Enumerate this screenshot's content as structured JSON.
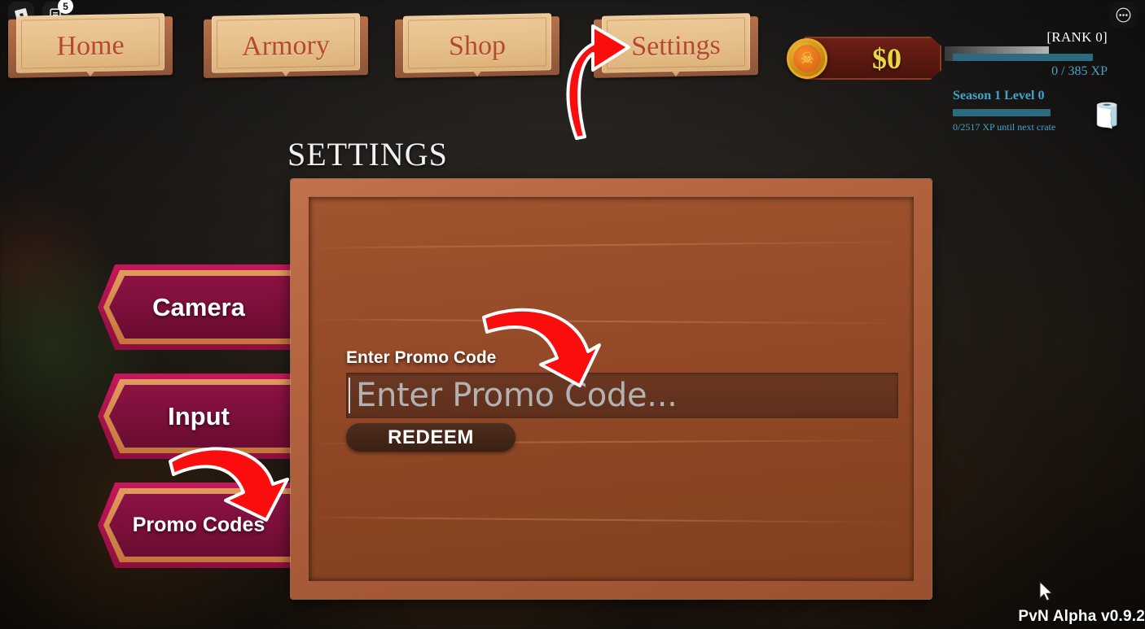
{
  "roblox": {
    "logo_icon": "roblox-logo-icon",
    "chat_icon": "chat-list-icon",
    "chat_badge": "5",
    "more_icon": "more-options-icon"
  },
  "nav": {
    "tabs": [
      {
        "label": "Home",
        "active": false
      },
      {
        "label": "Armory",
        "active": false
      },
      {
        "label": "Shop",
        "active": false
      },
      {
        "label": "Settings",
        "active": true
      }
    ]
  },
  "hud": {
    "currency": {
      "amount": "$0",
      "coin_icon": "skull-coin-icon"
    },
    "rank": {
      "label": "[RANK 0]",
      "xp_text": "0 / 385 XP"
    },
    "season": {
      "label": "Season 1 Level 0",
      "crate_text": "0/2517 XP until next crate",
      "crate_icon": "treasure-crate-icon"
    }
  },
  "page": {
    "title": "SETTINGS"
  },
  "sidebar": {
    "items": [
      {
        "label": "Camera",
        "selected": false
      },
      {
        "label": "Input",
        "selected": false
      },
      {
        "label": "Promo Codes",
        "selected": true
      }
    ]
  },
  "promo": {
    "label": "Enter Promo Code",
    "input_value": "",
    "input_placeholder": "Enter Promo Code...",
    "redeem_label": "REDEEM"
  },
  "annotations": [
    {
      "name": "arrow-to-settings-tab",
      "color": "#fb0d0d"
    },
    {
      "name": "arrow-to-promo-input",
      "color": "#fb0d0d"
    },
    {
      "name": "arrow-to-promo-codes",
      "color": "#fb0d0d"
    }
  ],
  "footer": {
    "version": "PvN Alpha v0.9.2"
  },
  "colors": {
    "accent_red": "#fb0d0d",
    "tab_text": "#b5482f",
    "parchment": "#e7c08c",
    "panel_wood": "#a0542f",
    "frame_wood": "#b0603c",
    "sidebar_fill": "#8d1244",
    "sidebar_border": "#c5185b",
    "sidebar_gold": "#e39a5e",
    "currency_gold": "#e8d846",
    "xp_blue": "#3fa5cc",
    "xp_bar": "#2c6a80"
  }
}
